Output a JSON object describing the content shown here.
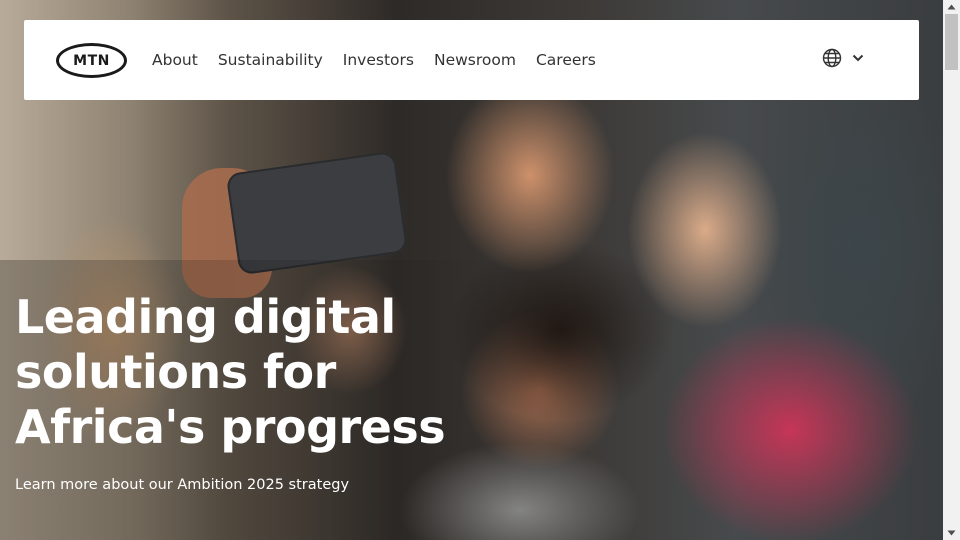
{
  "header": {
    "logo_text": "MTN",
    "nav": [
      {
        "label": "About"
      },
      {
        "label": "Sustainability"
      },
      {
        "label": "Investors"
      },
      {
        "label": "Newsroom"
      },
      {
        "label": "Careers"
      }
    ],
    "language_icon": "globe-icon",
    "language_chevron_icon": "chevron-down-icon"
  },
  "hero": {
    "headline_lines": [
      "Leading digital",
      "solutions for",
      "Africa's progress"
    ],
    "cta_text": "Learn more about our Ambition 2025 strategy",
    "text_color": "#ffffff"
  },
  "colors": {
    "header_bg": "#ffffff",
    "nav_text": "#333333",
    "logo": "#1a1a1a"
  }
}
